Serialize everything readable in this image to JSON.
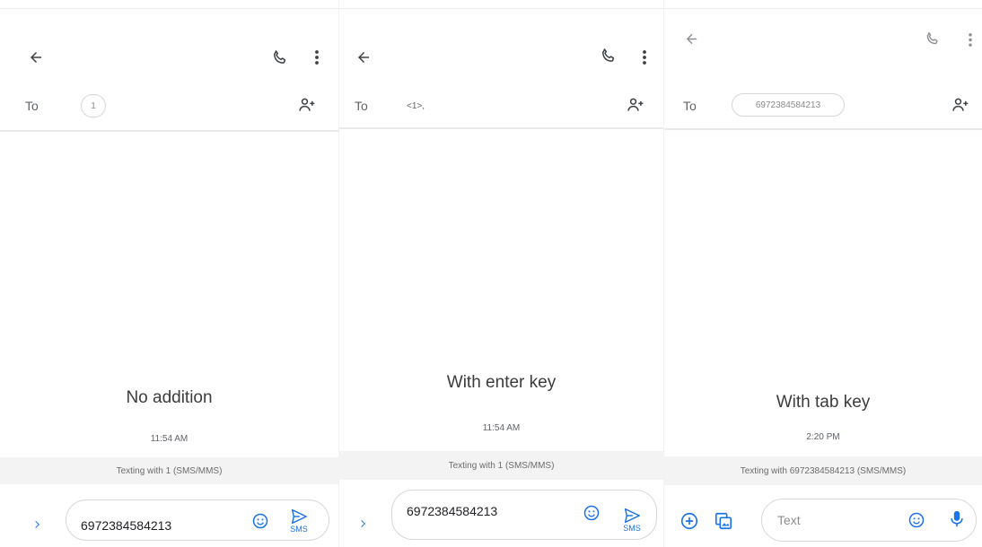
{
  "panels": [
    {
      "to_label": "To",
      "recipient_chip": "1",
      "caption": "No addition",
      "timestamp": "11:54 AM",
      "status": "Texting with 1 (SMS/MMS)",
      "message_value": "6972384584213",
      "send_label": "SMS"
    },
    {
      "to_label": "To",
      "recipient_text": "<1>,",
      "caption": "With enter key",
      "timestamp": "11:54 AM",
      "status": "Texting with 1 (SMS/MMS)",
      "message_value": "6972384584213",
      "send_label": "SMS"
    },
    {
      "to_label": "To",
      "recipient_chip": "6972384584213",
      "caption": "With tab key",
      "timestamp": "2:20 PM",
      "status": "Texting with 6972384584213 (SMS/MMS)",
      "message_placeholder": "Text"
    }
  ],
  "icons": {
    "back": "arrow-left-icon",
    "call": "phone-icon",
    "more": "more-vert-icon",
    "add_contact": "add-person-icon",
    "expand": "chevron-right-icon",
    "emoji": "emoji-icon",
    "send": "send-icon",
    "attach": "add-circle-icon",
    "gallery": "gallery-icon",
    "mic": "mic-icon"
  },
  "colors": {
    "accent": "#1a73e8",
    "icon": "#3c4043",
    "divider": "#e9e9e9",
    "status_bg": "#f3f3f3"
  }
}
